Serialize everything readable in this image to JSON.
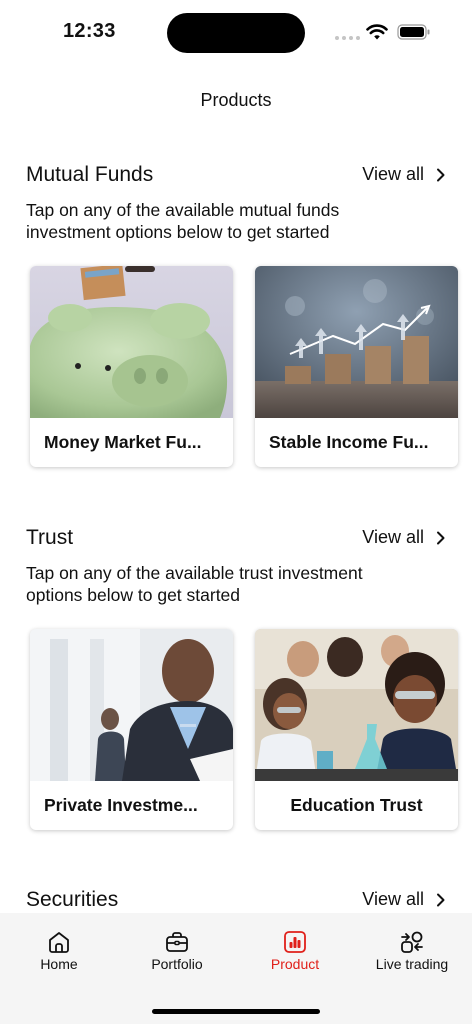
{
  "status_bar": {
    "time": "12:33"
  },
  "nav": {
    "title": "Products"
  },
  "sections": [
    {
      "title": "Mutual Funds",
      "view_all": "View all",
      "description": "Tap on any of the available mutual funds investment options below to get started",
      "cards": [
        {
          "label": "Money Market Fu..."
        },
        {
          "label": "Stable Income Fu..."
        }
      ]
    },
    {
      "title": "Trust",
      "view_all": "View all",
      "description": "Tap on any of the available trust investment options below to get started",
      "cards": [
        {
          "label": "Private Investme..."
        },
        {
          "label": "Education Trust"
        }
      ]
    },
    {
      "title": "Securities",
      "view_all": "View all"
    }
  ],
  "tab_bar": {
    "active": "Product",
    "accent_color": "#e0201a",
    "tabs": [
      {
        "label": "Home",
        "icon": "home-icon"
      },
      {
        "label": "Portfolio",
        "icon": "briefcase-icon"
      },
      {
        "label": "Product",
        "icon": "chart-icon"
      },
      {
        "label": "Live trading",
        "icon": "live-trading-icon"
      }
    ]
  }
}
